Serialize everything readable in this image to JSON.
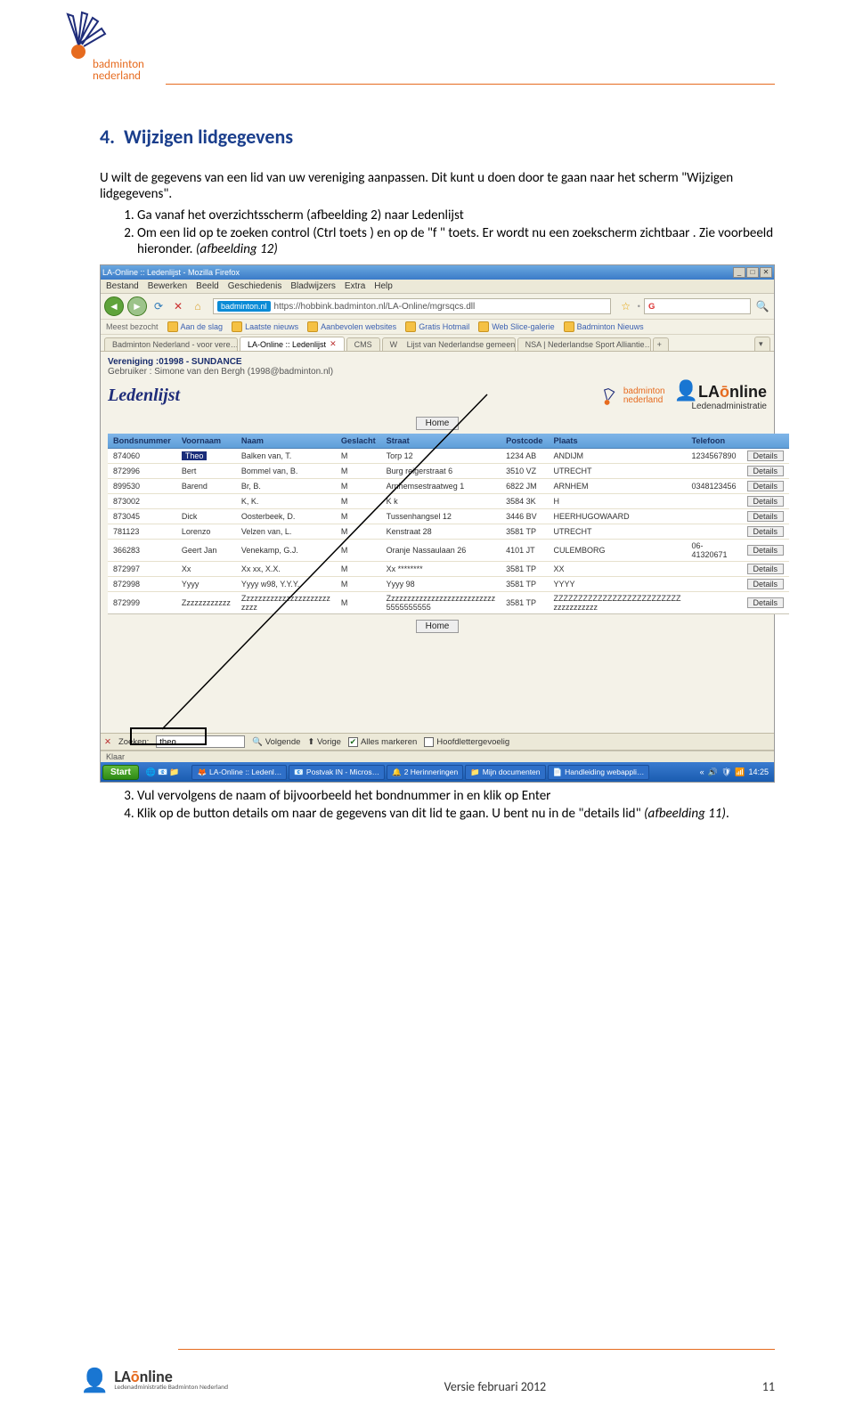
{
  "doc": {
    "brand_line1": "badminton",
    "brand_line2": "nederland",
    "section_number": "4.",
    "section_title": "Wijzigen lidgegevens",
    "intro": "U wilt de gegevens van een lid van uw vereniging aanpassen. Dit kunt u doen door te gaan naar het scherm \"Wijzigen lidgegevens\".",
    "step1": "Ga vanaf het overzichtsscherm (afbeelding 2) naar Ledenlijst",
    "step2a": "Om een lid op te zoeken control (Ctrl toets ) en op de \"f \" toets. Er wordt nu een zoekscherm zichtbaar . Zie voorbeeld hieronder. ",
    "step2b": "(afbeelding 12)",
    "step3": "Vul vervolgens de naam of bijvoorbeeld het bondnummer in en klik op Enter",
    "step4a": "Klik op de button details om naar de gegevens van dit lid te gaan. U bent nu in de \"details lid\" ",
    "step4b": "(afbeelding 11)",
    "footer_center": "Versie februari 2012",
    "footer_page": "11"
  },
  "shot": {
    "window_title": "LA-Online :: Ledenlijst - Mozilla Firefox",
    "menus": [
      "Bestand",
      "Bewerken",
      "Beeld",
      "Geschiedenis",
      "Bladwijzers",
      "Extra",
      "Help"
    ],
    "url_site": "badminton.nl",
    "url_path": "https://hobbink.badminton.nl/LA-Online/mgrsqcs.dll",
    "bookmark_label": "Meest bezocht",
    "bookmarks": [
      "Aan de slag",
      "Laatste nieuws",
      "Aanbevolen websites",
      "Gratis Hotmail",
      "Web Slice-galerie",
      "Badminton Nieuws"
    ],
    "tabs": [
      "Badminton Nederland - voor vere…",
      "LA-Online :: Ledenlijst",
      "CMS",
      "Lijst van Nederlandse gemeente…",
      "NSA | Nederlandse Sport Alliantie…"
    ],
    "active_tab": 1,
    "info_line1": "Vereniging :01998 - SUNDANCE",
    "info_line2": "Gebruiker : Simone van den Bergh (1998@badminton.nl)",
    "page_title": "Ledenlijst",
    "mini_brand1": "badminton",
    "mini_brand2": "nederland",
    "la_title": "LA",
    "la_suffix": "nline",
    "la_sub": "Ledenadministratie",
    "home_label": "Home",
    "columns": [
      "Bondsnummer",
      "Voornaam",
      "Naam",
      "Geslacht",
      "Straat",
      "Postcode",
      "Plaats",
      "Telefoon",
      ""
    ],
    "rows": [
      {
        "b": "874060",
        "v": "Theo",
        "n": "Balken van, T.",
        "g": "M",
        "s": "Torp 12",
        "p": "1234 AB",
        "pl": "ANDIJM",
        "t": "1234567890",
        "hl": true
      },
      {
        "b": "872996",
        "v": "Bert",
        "n": "Bommel van, B.",
        "g": "M",
        "s": "Burg reigerstraat 6",
        "p": "3510 VZ",
        "pl": "UTRECHT",
        "t": ""
      },
      {
        "b": "899530",
        "v": "Barend",
        "n": "Br, B.",
        "g": "M",
        "s": "Arnhemsestraatweg 1",
        "p": "6822 JM",
        "pl": "ARNHEM",
        "t": "0348123456"
      },
      {
        "b": "873002",
        "v": "",
        "n": "K, K.",
        "g": "M",
        "s": "K k",
        "p": "3584 3K",
        "pl": "H",
        "t": ""
      },
      {
        "b": "873045",
        "v": "Dick",
        "n": "Oosterbeek, D.",
        "g": "M",
        "s": "Tussenhangsel 12",
        "p": "3446 BV",
        "pl": "HEERHUGOWAARD",
        "t": ""
      },
      {
        "b": "781123",
        "v": "Lorenzo",
        "n": "Velzen van, L.",
        "g": "M",
        "s": "Kenstraat 28",
        "p": "3581 TP",
        "pl": "UTRECHT",
        "t": ""
      },
      {
        "b": "366283",
        "v": "Geert Jan",
        "n": "Venekamp, G.J.",
        "g": "M",
        "s": "Oranje Nassaulaan 26",
        "p": "4101 JT",
        "pl": "CULEMBORG",
        "t": "06-41320671"
      },
      {
        "b": "872997",
        "v": "Xx",
        "n": "Xx xx, X.X.",
        "g": "M",
        "s": "Xx ********",
        "p": "3581 TP",
        "pl": "XX",
        "t": ""
      },
      {
        "b": "872998",
        "v": "Yyyy",
        "n": "Yyyy w98, Y.Y.Y.",
        "g": "M",
        "s": "Yyyy 98",
        "p": "3581 TP",
        "pl": "YYYY",
        "t": ""
      },
      {
        "b": "872999",
        "v": "Zzzzzzzzzzzz",
        "n": "Zzzzzzzzzzzzzzzzzzzzzz zzzz",
        "g": "M",
        "s": "Zzzzzzzzzzzzzzzzzzzzzzzzzzz 5555555555",
        "p": "3581 TP",
        "pl": "ZZZZZZZZZZZZZZZZZZZZZZZZZZ zzzzzzzzzzz",
        "t": ""
      }
    ],
    "details_label": "Details",
    "find_label": "Zoeken:",
    "find_value": "theo",
    "find_next": "Volgende",
    "find_prev": "Vorige",
    "find_highlight": "Alles markeren",
    "find_case": "Hoofdlettergevoelig",
    "status": "Klaar",
    "start": "Start",
    "task_items": [
      "LA-Online :: Ledenl…",
      "Postvak IN - Micros…",
      "2 Herinneringen",
      "Mijn documenten",
      "Handleiding webappli…"
    ],
    "clock": "14:25"
  }
}
